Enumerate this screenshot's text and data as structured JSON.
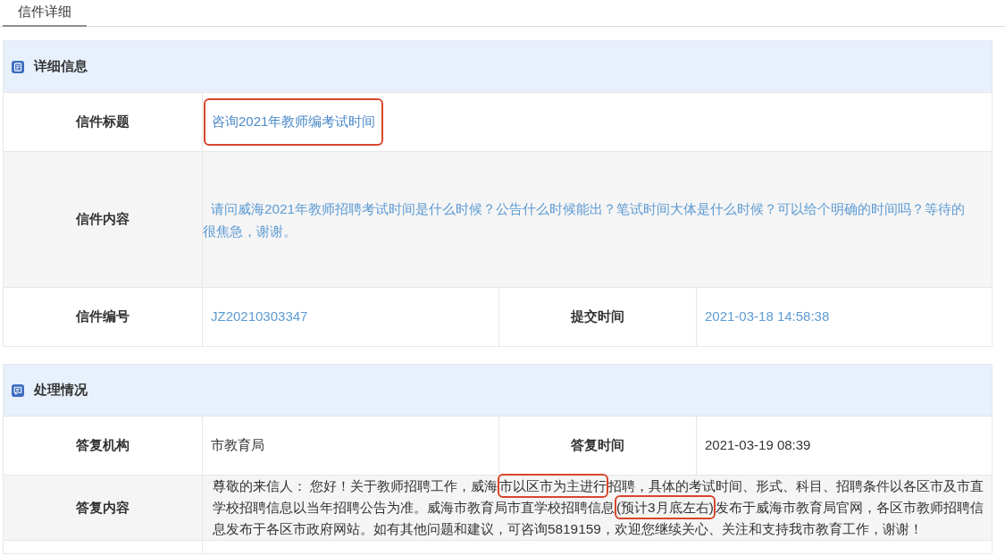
{
  "tab": {
    "label": "信件详细",
    "selected": true
  },
  "sections": [
    {
      "kind": "details",
      "title": "详细信息",
      "rows": [
        {
          "kind": "single",
          "label": "信件标题",
          "value": "咨询2021年教师编考试时间",
          "highlighted": true
        },
        {
          "kind": "text",
          "label": "信件内容",
          "segments": [
            {
              "text": "请问威海2021年教师招聘考试时间是什么时候？公告什么时候能出？笔试时间大体是什么时候？可以给个明确的时间吗？等待的很焦急，谢谢。",
              "highlighted": false
            }
          ]
        },
        {
          "kind": "pair",
          "cells": [
            {
              "label": "信件编号",
              "value": "JZ20210303347"
            },
            {
              "label": "提交时间",
              "value": "2021-03-18 14:58:38"
            }
          ]
        }
      ]
    },
    {
      "kind": "handling",
      "title": "处理情况",
      "rows": [
        {
          "kind": "pair",
          "cells": [
            {
              "label": "答复机构",
              "value": "市教育局"
            },
            {
              "label": "答复时间",
              "value": "2021-03-19 08:39"
            }
          ]
        },
        {
          "kind": "text",
          "label": "答复内容",
          "segments": [
            {
              "text": "尊敬的来信人： 您好！关于教师招聘工作，威海",
              "highlighted": false
            },
            {
              "text": "市以区市为主进行",
              "highlighted": true
            },
            {
              "text": "招聘，具体的考试时间、形式、科目、招聘条件以各区市及市直学校招聘信息以当年招聘公告为准。威海市教育局市直学校招聘信息",
              "highlighted": false
            },
            {
              "text": "(预计3月底左右)",
              "highlighted": true
            },
            {
              "text": "发布于威海市教育局官网，各区市教师招聘信息发布于各区市政府网站。如有其他问题和建议，可咨询5819159，欢迎您继续关心、关注和支持我市教育工作，谢谢！",
              "highlighted": false
            }
          ]
        }
      ]
    }
  ]
}
